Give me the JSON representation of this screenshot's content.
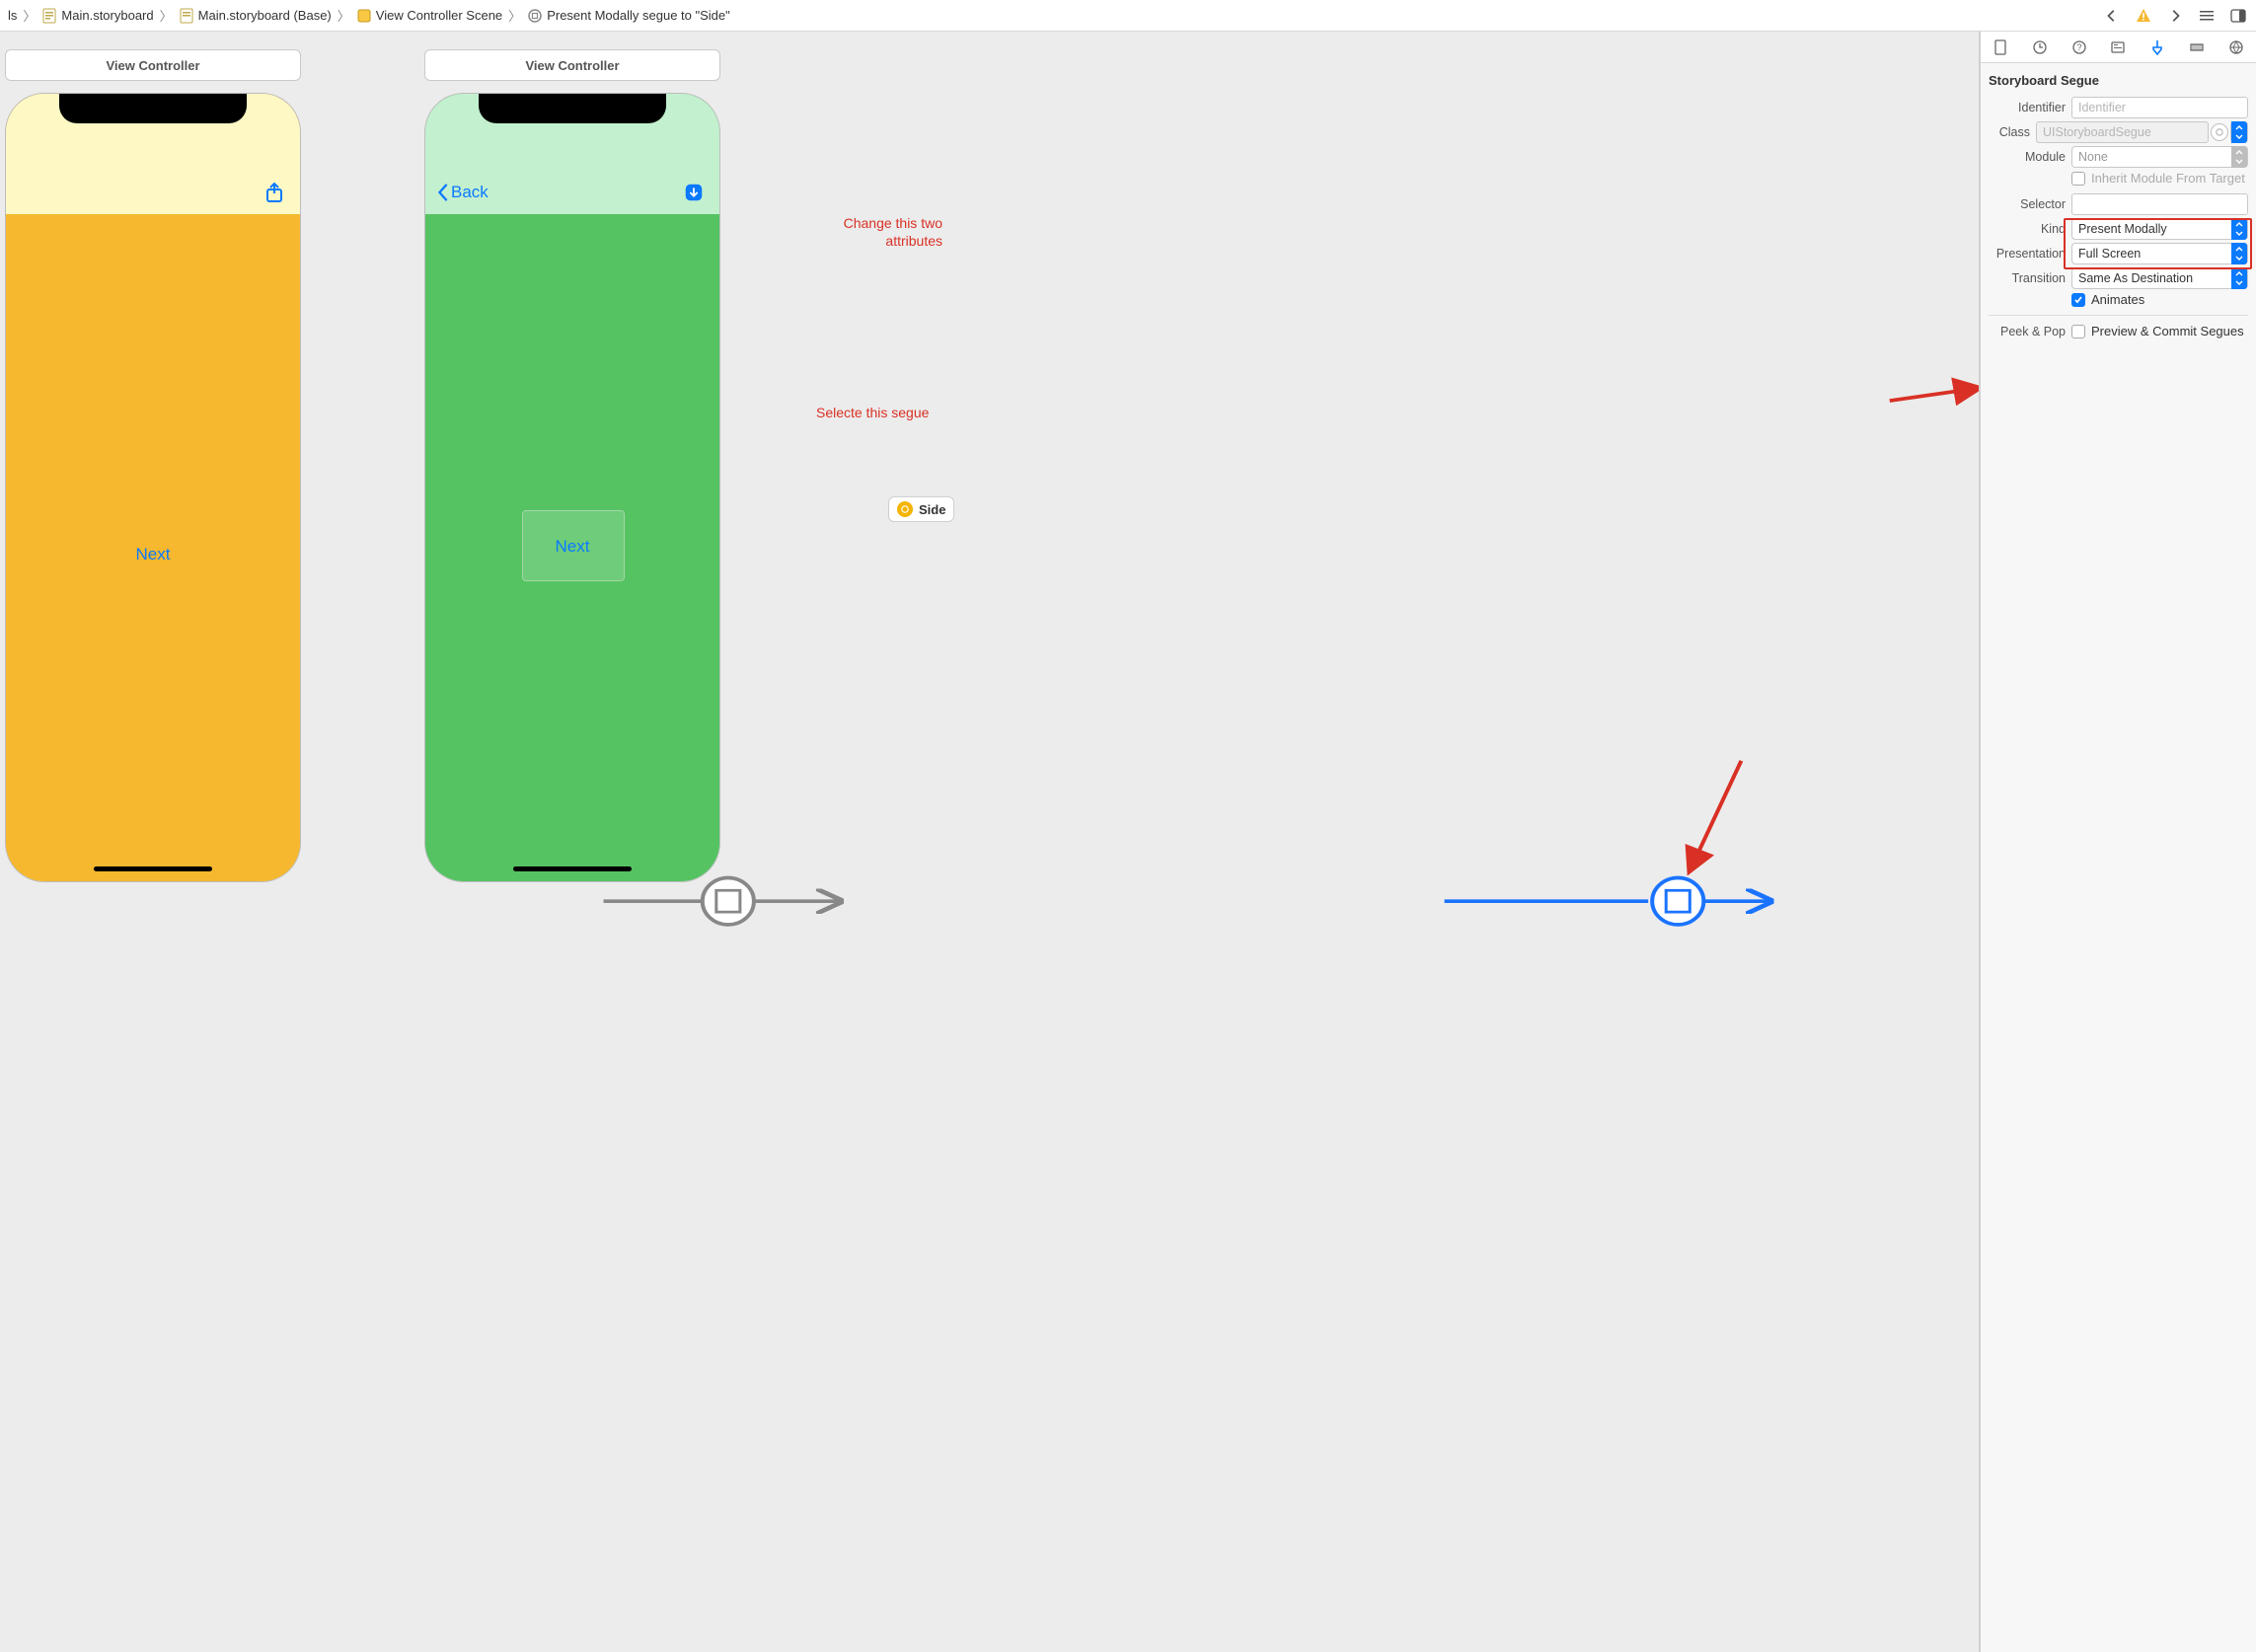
{
  "breadcrumbs": {
    "item0": "ls",
    "item1": "Main.storyboard",
    "item2": "Main.storyboard (Base)",
    "item3": "View Controller Scene",
    "item4": "Present Modally segue to \"Side\""
  },
  "scenes": {
    "vc1": {
      "title": "View Controller",
      "next_label": "Next"
    },
    "vc2": {
      "title": "View Controller",
      "back_label": "Back",
      "next_label": "Next"
    }
  },
  "side_badge": {
    "label": "Side"
  },
  "annotations": {
    "select_segue": "Selecte this segue",
    "change_attrs": "Change this two attributes"
  },
  "inspector": {
    "section_title": "Storyboard Segue",
    "identifier_label": "Identifier",
    "identifier_placeholder": "Identifier",
    "identifier_value": "",
    "class_label": "Class",
    "class_value": "UIStoryboardSegue",
    "module_label": "Module",
    "module_value": "None",
    "inherit_label": "Inherit Module From Target",
    "inherit_checked": false,
    "selector_label": "Selector",
    "selector_value": "",
    "kind_label": "Kind",
    "kind_value": "Present Modally",
    "presentation_label": "Presentation",
    "presentation_value": "Full Screen",
    "transition_label": "Transition",
    "transition_value": "Same As Destination",
    "animates_label": "Animates",
    "animates_checked": true,
    "peek_label": "Peek & Pop",
    "peek_option": "Preview & Commit Segues",
    "peek_checked": false
  },
  "colors": {
    "blue": "#0a7aff",
    "red": "#d93025",
    "orange_body": "#f5b82e",
    "orange_top": "#fdf8c4",
    "green_body": "#56c363",
    "green_top": "#c3f0ce"
  }
}
